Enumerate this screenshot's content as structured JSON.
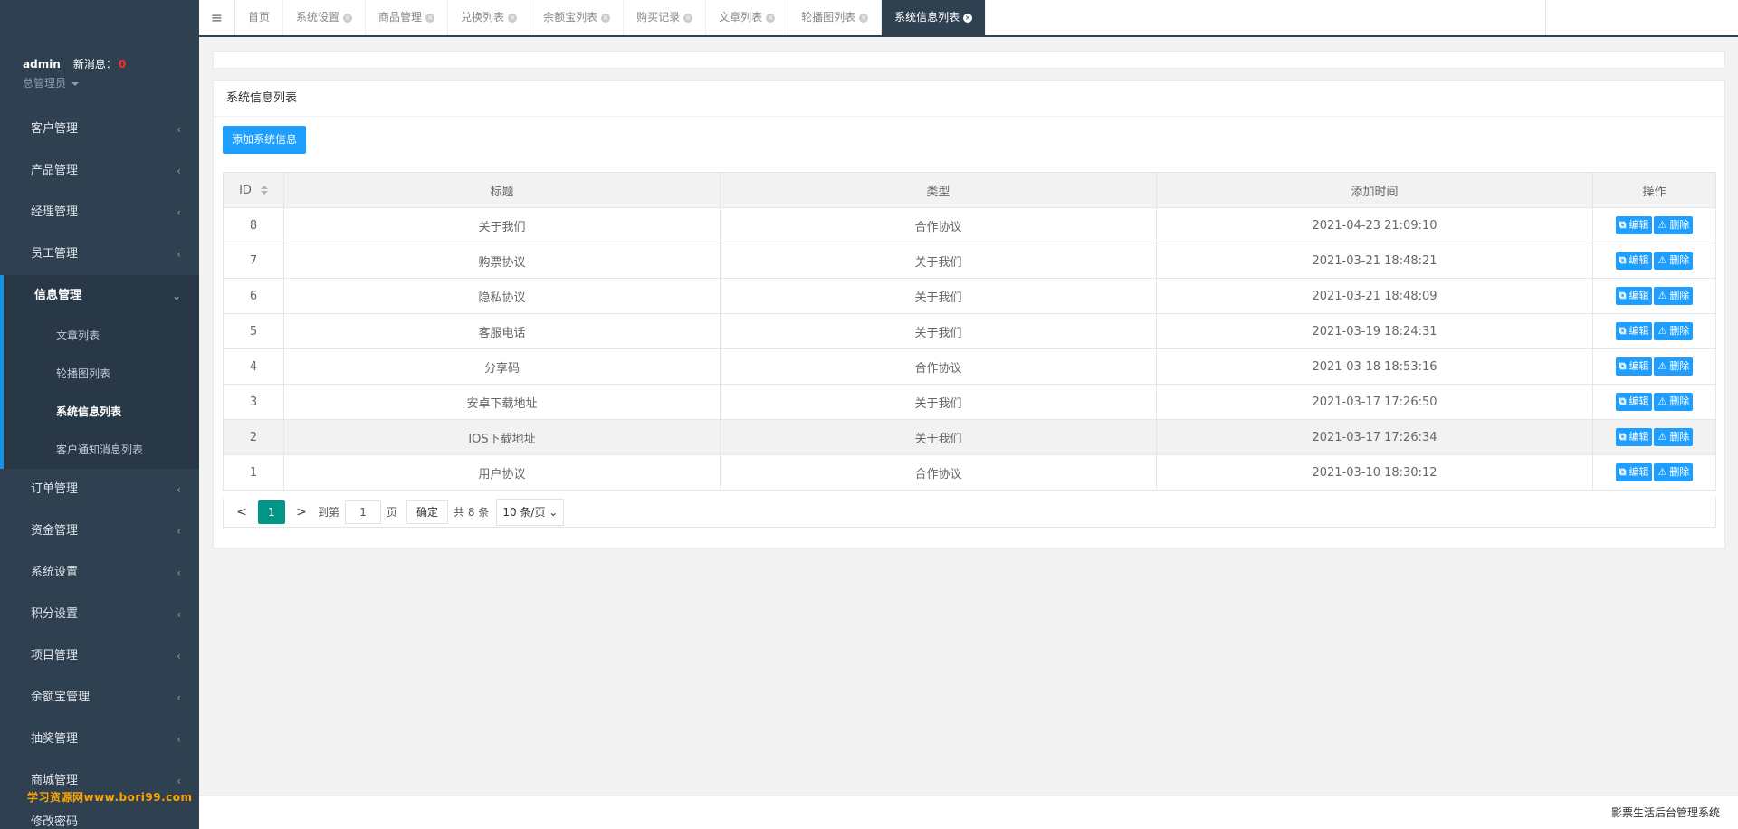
{
  "sidebar": {
    "user": "admin",
    "msg_label": "新消息：",
    "msg_count": "0",
    "role": "总管理员",
    "menu_top": [
      "客户管理",
      "产品管理",
      "经理管理",
      "员工管理"
    ],
    "active_menu": "信息管理",
    "submenu": [
      "文章列表",
      "轮播图列表",
      "系统信息列表",
      "客户通知消息列表"
    ],
    "menu_bottom": [
      "订单管理",
      "资金管理",
      "系统设置",
      "积分设置",
      "项目管理",
      "余额宝管理",
      "抽奖管理",
      "商城管理",
      "修改密码"
    ],
    "watermark": "学习资源网www.bori99.com"
  },
  "tabs": [
    "首页",
    "系统设置",
    "商品管理",
    "兑换列表",
    "余额宝列表",
    "购买记录",
    "文章列表",
    "轮播图列表",
    "系统信息列表"
  ],
  "panel": {
    "title": "系统信息列表",
    "add_button": "添加系统信息"
  },
  "table": {
    "headers": [
      "ID",
      "标题",
      "类型",
      "添加时间",
      "操作"
    ],
    "rows": [
      {
        "id": "8",
        "title": "关于我们",
        "type": "合作协议",
        "time": "2021-04-23 21:09:10"
      },
      {
        "id": "7",
        "title": "购票协议",
        "type": "关于我们",
        "time": "2021-03-21 18:48:21"
      },
      {
        "id": "6",
        "title": "隐私协议",
        "type": "关于我们",
        "time": "2021-03-21 18:48:09"
      },
      {
        "id": "5",
        "title": "客服电话",
        "type": "关于我们",
        "time": "2021-03-19 18:24:31"
      },
      {
        "id": "4",
        "title": "分享码",
        "type": "合作协议",
        "time": "2021-03-18 18:53:16"
      },
      {
        "id": "3",
        "title": "安卓下载地址",
        "type": "关于我们",
        "time": "2021-03-17 17:26:50"
      },
      {
        "id": "2",
        "title": "IOS下载地址",
        "type": "关于我们",
        "time": "2021-03-17 17:26:34"
      },
      {
        "id": "1",
        "title": "用户协议",
        "type": "合作协议",
        "time": "2021-03-10 18:30:12"
      }
    ],
    "edit_label": "编辑",
    "delete_label": "删除"
  },
  "pager": {
    "current": "1",
    "goto_label": "到第",
    "page_input": "1",
    "page_label": "页",
    "confirm": "确定",
    "total": "共 8 条",
    "per_page": "10 条/页"
  },
  "footer": "影票生活后台管理系统",
  "colors": {
    "sidebar": "#2f4050",
    "primary": "#1e9fff",
    "page_active": "#009688",
    "badge": "#ff2a2a"
  }
}
